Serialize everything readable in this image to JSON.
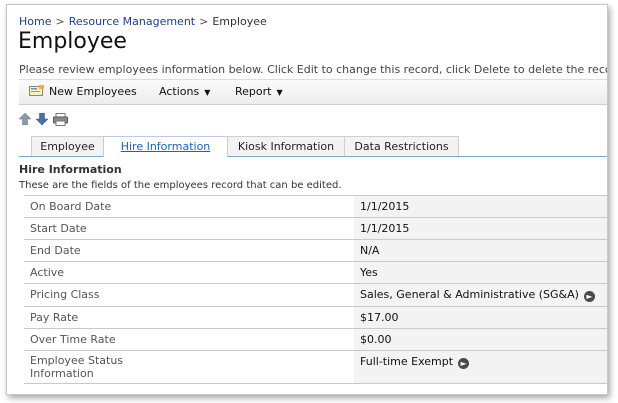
{
  "breadcrumb": {
    "home": "Home",
    "sep": ">",
    "section": "Resource Management",
    "current": "Employee"
  },
  "page": {
    "title": "Employee",
    "instructions": "Please review employees information below. Click Edit to change this record, click Delete to delete the record"
  },
  "toolbar": {
    "new_label": "New Employees",
    "actions_label": "Actions",
    "report_label": "Report",
    "caret": "▼"
  },
  "nav_icons": {
    "up": "arrow-up-icon",
    "down": "arrow-down-icon",
    "print": "printer-icon"
  },
  "tabs": [
    {
      "label": "Employee"
    },
    {
      "label": "Hire Information",
      "active": true
    },
    {
      "label": "Kiosk Information"
    },
    {
      "label": "Data Restrictions"
    }
  ],
  "section": {
    "title": "Hire Information",
    "subtitle": "These are the fields of the employees record that can be edited."
  },
  "fields": [
    {
      "label": "On Board Date",
      "value": "1/1/2015"
    },
    {
      "label": "Start Date",
      "value": "1/1/2015"
    },
    {
      "label": "End Date",
      "value": "N/A"
    },
    {
      "label": "Active",
      "value": "Yes"
    },
    {
      "label": "Pricing Class",
      "value": "Sales, General & Administrative (SG&A)"
    },
    {
      "label": "Pay Rate",
      "value": "$17.00"
    },
    {
      "label": "Over Time Rate",
      "value": "$0.00"
    },
    {
      "label": "Employee Status Information",
      "value": "Full-time Exempt"
    }
  ],
  "colors": {
    "link": "#1f3f8a",
    "active_tab": "#1a62b8",
    "tab_underline": "#7aa7d6"
  }
}
